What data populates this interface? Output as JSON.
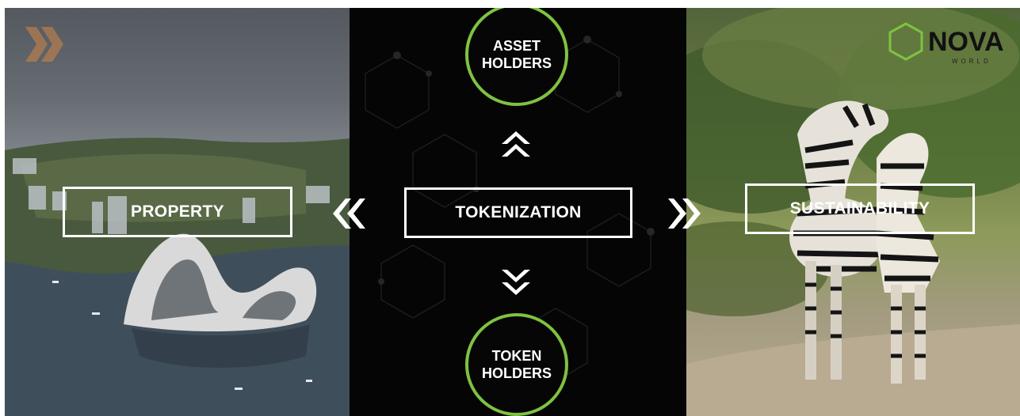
{
  "center": {
    "label": "TOKENIZATION",
    "top": {
      "line1": "ASSET",
      "line2": "HOLDERS"
    },
    "bottom": {
      "line1": "TOKEN",
      "line2": "HOLDERS"
    }
  },
  "left": {
    "label": "PROPERTY"
  },
  "right": {
    "label": "SUSTAINABILITY"
  },
  "logo": {
    "word": "NOVA",
    "sub": "WORLD"
  },
  "colors": {
    "accent": "#7fc241",
    "white": "#ffffff"
  }
}
